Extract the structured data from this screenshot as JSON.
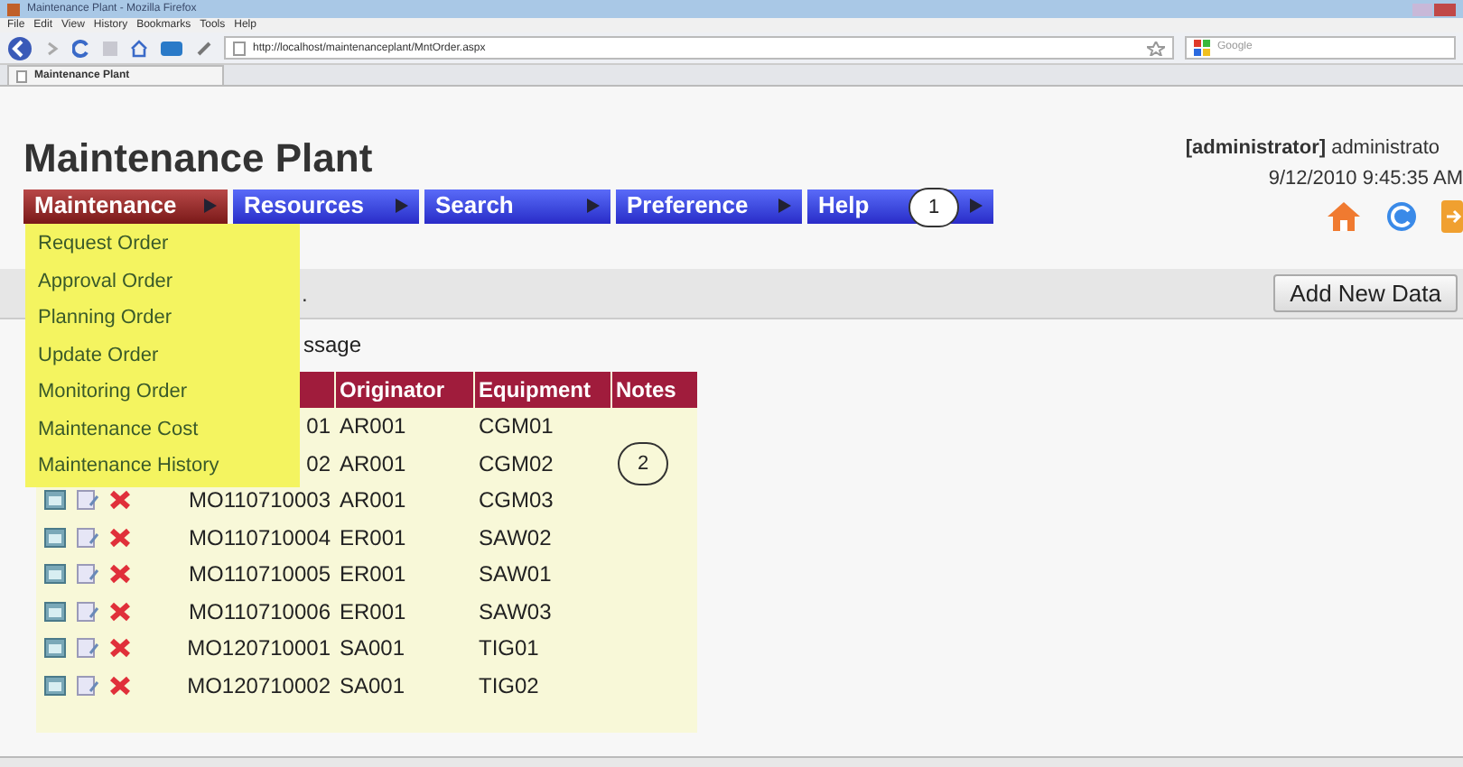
{
  "browser": {
    "title": "Maintenance Plant - Mozilla Firefox",
    "menu": [
      "File",
      "Edit",
      "View",
      "History",
      "Bookmarks",
      "Tools",
      "Help"
    ],
    "url": "http://localhost/maintenanceplant/MntOrder.aspx",
    "search_placeholder": "Google",
    "tab": "Maintenance Plant"
  },
  "page": {
    "title": "Maintenance Plant",
    "user": "**[administrator]** administrato",
    "datetime": "9/12/2010 9:45:35 AM"
  },
  "menu": [
    {
      "label": "Maintenance",
      "selected": true
    },
    {
      "label": "Resources",
      "selected": false
    },
    {
      "label": "Search",
      "selected": false
    },
    {
      "label": "Preference",
      "selected": false
    },
    {
      "label": "Help",
      "selected": false
    }
  ],
  "dropdown": [
    "Request Order",
    "Approval Order",
    "Planning Order",
    "Update Order",
    "Monitoring Order",
    "Maintenance Cost",
    "Maintenance History"
  ],
  "toolbar": {
    "text": ".",
    "button": "Add New Data"
  },
  "message": "ssage",
  "table": {
    "columns": [
      "Originator",
      "Equipment",
      "Notes"
    ],
    "rows": [
      {
        "kind": "partial",
        "order": "01",
        "originator": "AR001",
        "equipment": "CGM01"
      },
      {
        "kind": "partial",
        "order": "02",
        "originator": "AR001",
        "equipment": "CGM02"
      },
      {
        "kind": "full",
        "order": "MO110710003",
        "originator": "AR001",
        "equipment": "CGM03"
      },
      {
        "kind": "full",
        "order": "MO110710004",
        "originator": "ER001",
        "equipment": "SAW02"
      },
      {
        "kind": "full",
        "order": "MO110710005",
        "originator": "ER001",
        "equipment": "SAW01"
      },
      {
        "kind": "full",
        "order": "MO110710006",
        "originator": "ER001",
        "equipment": "SAW03"
      },
      {
        "kind": "full",
        "order": "MO120710001",
        "originator": "SA001",
        "equipment": "TIG01"
      },
      {
        "kind": "full",
        "order": "MO120710002",
        "originator": "SA001",
        "equipment": "TIG02"
      }
    ]
  },
  "callouts": [
    "1",
    "2"
  ]
}
